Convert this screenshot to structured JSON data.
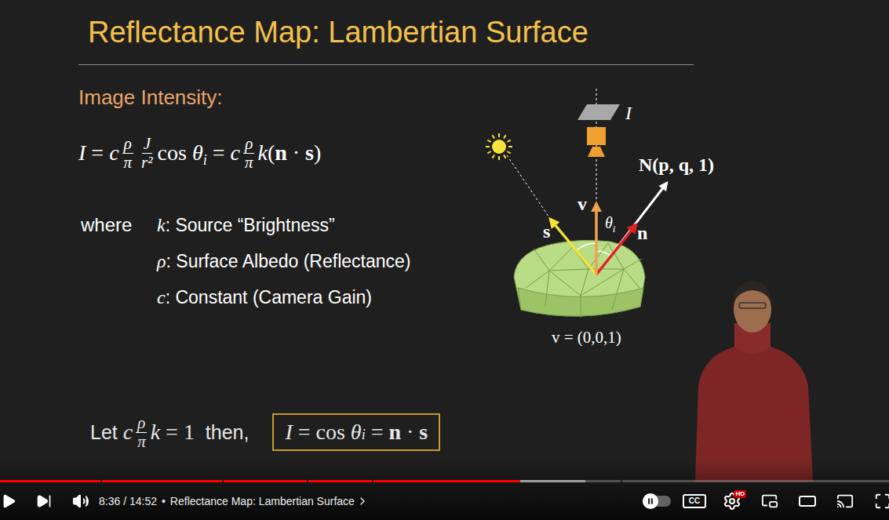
{
  "slide": {
    "title": "Reflectance Map: Lambertian Surface",
    "section": "Image Intensity:",
    "equation": [
      {
        "kind": "var",
        "text": "I"
      },
      {
        "kind": "op",
        "text": " = "
      },
      {
        "kind": "var",
        "text": "c"
      },
      {
        "kind": "frac",
        "num": "ρ",
        "den": "π"
      },
      {
        "kind": "frac",
        "num": "J",
        "den": "r²"
      },
      {
        "kind": "op",
        "text": "cos "
      },
      {
        "kind": "var",
        "text": "θ"
      },
      {
        "kind": "sub",
        "text": "i"
      },
      {
        "kind": "op",
        "text": " = "
      },
      {
        "kind": "var",
        "text": "c"
      },
      {
        "kind": "frac",
        "num": "ρ",
        "den": "π"
      },
      {
        "kind": "var",
        "text": "k"
      },
      {
        "kind": "op",
        "text": "("
      },
      {
        "kind": "bold",
        "text": "n"
      },
      {
        "kind": "op",
        "text": " · "
      },
      {
        "kind": "bold",
        "text": "s"
      },
      {
        "kind": "op",
        "text": ")"
      }
    ],
    "where": "where",
    "definitions": [
      {
        "symbol": "k",
        "text": ": Source “Brightness”"
      },
      {
        "symbol": "ρ",
        "text": ": Surface Albedo (Reflectance)"
      },
      {
        "symbol": "c",
        "text": ": Constant (Camera Gain)"
      }
    ],
    "assumption": [
      {
        "kind": "label",
        "text": "Let "
      },
      {
        "kind": "var",
        "text": "c"
      },
      {
        "kind": "frac",
        "num": "ρ",
        "den": "π"
      },
      {
        "kind": "var",
        "text": "k"
      },
      {
        "kind": "op",
        "text": " = 1"
      },
      {
        "kind": "label",
        "text": "  then,"
      }
    ],
    "result": [
      {
        "kind": "var",
        "text": "I"
      },
      {
        "kind": "op",
        "text": " = cos "
      },
      {
        "kind": "var",
        "text": "θ"
      },
      {
        "kind": "sub",
        "text": "i"
      },
      {
        "kind": "op",
        "text": " = "
      },
      {
        "kind": "bold",
        "text": "n"
      },
      {
        "kind": "op",
        "text": " · "
      },
      {
        "kind": "bold",
        "text": "s"
      }
    ],
    "diagram": {
      "plane": "I",
      "normal": "N(p, q, 1)",
      "view": "v",
      "source": "s",
      "angle": "θ",
      "angle_sub": "i",
      "unit_normal": "n",
      "view_value": "v = (0,0,1)"
    }
  },
  "player": {
    "playing": false,
    "progress": {
      "level": 0.585,
      "buffered": 0.658,
      "chapter_marks": [
        0.113,
        0.25,
        0.345,
        0.418,
        0.698
      ]
    },
    "time": "8:36 / 14:52",
    "separator": "•",
    "chapter": "Reflectance Map: Lambertian Surface",
    "autoplay": false,
    "captions": {
      "label": "CC",
      "on": false
    },
    "settings_badge": "HD"
  }
}
